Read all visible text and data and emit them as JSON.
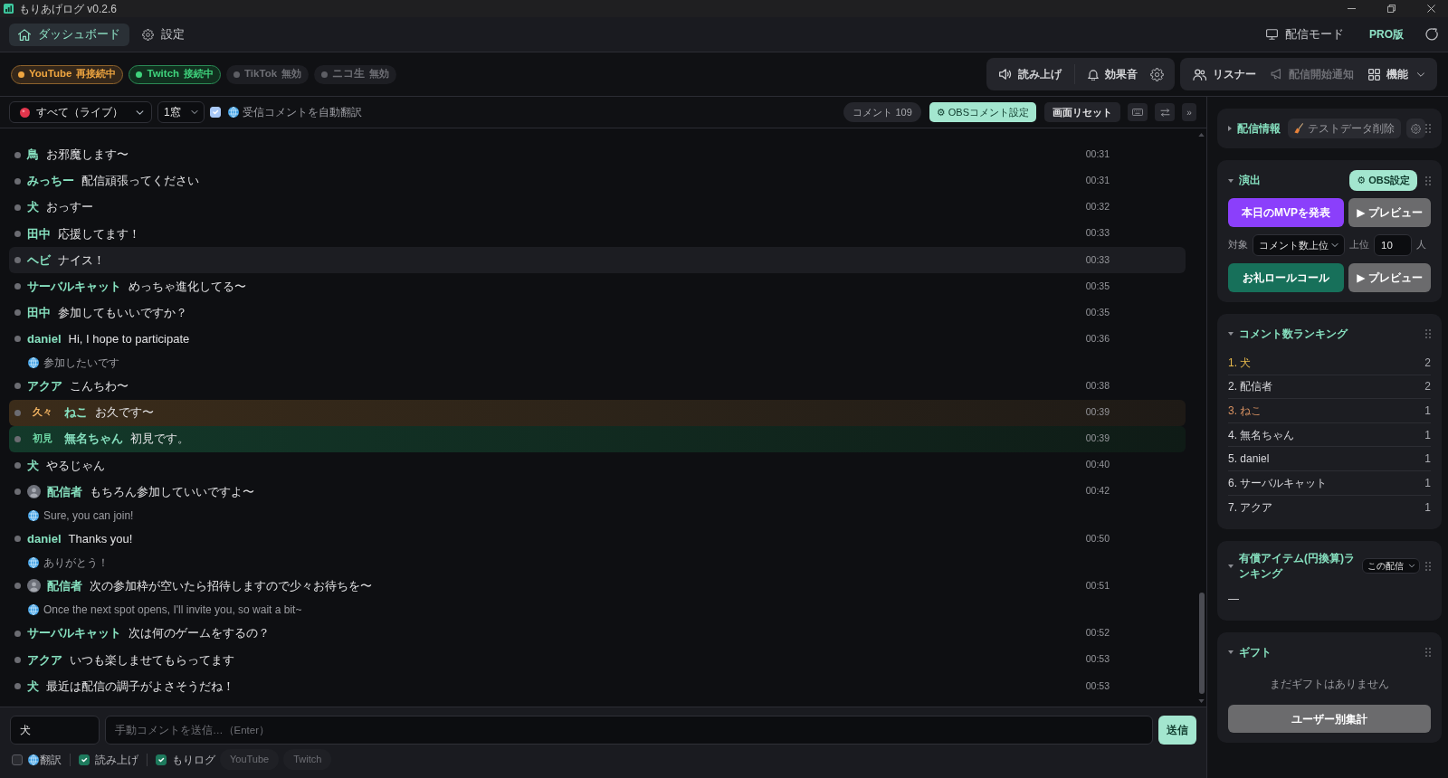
{
  "window": {
    "title": "もりあげログ v0.2.6"
  },
  "nav": {
    "tabs": [
      {
        "label": "ダッシュボード",
        "selected": true
      },
      {
        "label": "設定",
        "selected": false
      }
    ],
    "stream_mode": "配信モード",
    "plan": "PRO版"
  },
  "platforms": [
    {
      "name": "YouTube",
      "status": "再接続中",
      "kind": "reconnecting"
    },
    {
      "name": "Twitch",
      "status": "接続中",
      "kind": "connected"
    },
    {
      "name": "TikTok",
      "status": "無効",
      "kind": "disabled"
    },
    {
      "name": "ニコ生",
      "status": "無効",
      "kind": "disabled"
    }
  ],
  "toolbar": {
    "read_aloud": {
      "label": "読み上げ",
      "disabled": false
    },
    "sound_effects": {
      "label": "効果音",
      "disabled": false
    },
    "listeners": {
      "label": "リスナー",
      "disabled": false
    },
    "stream_notice": {
      "label": "配信開始通知",
      "disabled": true
    },
    "features": {
      "label": "機能",
      "disabled": false
    }
  },
  "chat_toolbar": {
    "source": "すべて（ライブ）",
    "windows": "1窓",
    "auto_translate": {
      "label": "受信コメントを自動翻訳",
      "checked": true
    },
    "comment_count": "コメント 109",
    "obs_button": "⚙ OBSコメント設定",
    "reset_button": "画面リセット",
    "more_button": "»"
  },
  "messages": [
    {
      "name": "鳥",
      "text": "お邪魔します〜",
      "time": "00:31",
      "kind": "viewer",
      "selected": false
    },
    {
      "name": "みっちー",
      "text": "配信頑張ってください",
      "time": "00:31",
      "kind": "viewer",
      "selected": false
    },
    {
      "name": "犬",
      "text": "おっすー",
      "time": "00:32",
      "kind": "viewer",
      "selected": false
    },
    {
      "name": "田中",
      "text": "応援してます！",
      "time": "00:33",
      "kind": "viewer",
      "selected": false
    },
    {
      "name": "ヘビ",
      "text": "ナイス！",
      "time": "00:33",
      "kind": "viewer",
      "selected": true
    },
    {
      "name": "サーバルキャット",
      "text": "めっちゃ進化してる〜",
      "time": "00:35",
      "kind": "viewer",
      "selected": false
    },
    {
      "name": "田中",
      "text": "参加してもいいですか？",
      "time": "00:35",
      "kind": "viewer",
      "selected": false
    },
    {
      "name": "daniel",
      "text": "Hi, I hope to participate",
      "time": "00:36",
      "kind": "viewer",
      "selected": false,
      "translation": "参加したいです"
    },
    {
      "name": "アクア",
      "text": "こんちわ〜",
      "time": "00:38",
      "kind": "viewer",
      "selected": false
    },
    {
      "name": "ねこ",
      "text": "お久です〜",
      "time": "00:39",
      "kind": "returning",
      "tag": "久々",
      "selected": false
    },
    {
      "name": "無名ちゃん",
      "text": "初見です。",
      "time": "00:39",
      "kind": "first",
      "tag": "初見",
      "selected": false
    },
    {
      "name": "犬",
      "text": "やるじゃん",
      "time": "00:40",
      "kind": "viewer",
      "selected": false
    },
    {
      "name": "配信者",
      "text": "もちろん参加していいですよ〜",
      "time": "00:42",
      "kind": "streamer",
      "selected": false,
      "translation": "Sure, you can join!"
    },
    {
      "name": "daniel",
      "text": "Thanks you!",
      "time": "00:50",
      "kind": "viewer",
      "selected": false,
      "translation": "ありがとう！"
    },
    {
      "name": "配信者",
      "text": "次の参加枠が空いたら招待しますので少々お待ちを〜",
      "time": "00:51",
      "kind": "streamer",
      "selected": false,
      "translation": "Once the next spot opens, I'll invite you, so wait a bit~"
    },
    {
      "name": "サーバルキャット",
      "text": "次は何のゲームをするの？",
      "time": "00:52",
      "kind": "viewer",
      "selected": false
    },
    {
      "name": "アクア",
      "text": "いつも楽しませてもらってます",
      "time": "00:53",
      "kind": "viewer",
      "selected": false
    },
    {
      "name": "犬",
      "text": "最近は配信の調子がよさそうだね！",
      "time": "00:53",
      "kind": "viewer",
      "selected": false
    }
  ],
  "composer": {
    "name_value": "犬",
    "placeholder": "手動コメントを送信…（Enter）",
    "send_button": "送信",
    "translate": {
      "label": "翻訳",
      "checked": false
    },
    "read_aloud": {
      "label": "読み上げ",
      "checked": true
    },
    "log": {
      "label": "もりログ",
      "checked": true
    },
    "targets": [
      {
        "label": "YouTube",
        "on": false
      },
      {
        "label": "Twitch",
        "on": false
      }
    ]
  },
  "side_panel": {
    "stream_info": {
      "title": "配信情報",
      "expanded": false,
      "clear_button": "テストデータ削除"
    },
    "effects": {
      "title": "演出",
      "expanded": true,
      "obs_button": "⚙ OBS設定",
      "mvp_button": "本日のMVPを発表",
      "mvp_preview": "▶ プレビュー",
      "target_label": "対象",
      "target": "コメント数上位",
      "top_label": "上位",
      "top_value": "10",
      "unit": "人",
      "rollcall_button": "お礼ロールコール",
      "rollcall_preview": "▶ プレビュー"
    },
    "comment_ranking": {
      "title": "コメント数ランキング",
      "expanded": true,
      "items": [
        {
          "label": "1. 犬",
          "count": "2",
          "color": "#e6b84c"
        },
        {
          "label": "2. 配信者",
          "count": "2",
          "color": "#d8d8dc"
        },
        {
          "label": "3. ねこ",
          "count": "1",
          "color": "#d99262"
        },
        {
          "label": "4. 無名ちゃん",
          "count": "1",
          "color": "#d8d8dc"
        },
        {
          "label": "5. daniel",
          "count": "1",
          "color": "#d8d8dc"
        },
        {
          "label": "6. サーバルキャット",
          "count": "1",
          "color": "#d8d8dc"
        },
        {
          "label": "7. アクア",
          "count": "1",
          "color": "#d8d8dc"
        }
      ]
    },
    "paid_ranking": {
      "title": "有償アイテム(円換算)ランキング",
      "expanded": true,
      "scope": "この配信",
      "empty": "—"
    },
    "gifts": {
      "title": "ギフト",
      "expanded": true,
      "empty": "まだギフトはありません",
      "summary_button": "ユーザー別集計"
    }
  }
}
